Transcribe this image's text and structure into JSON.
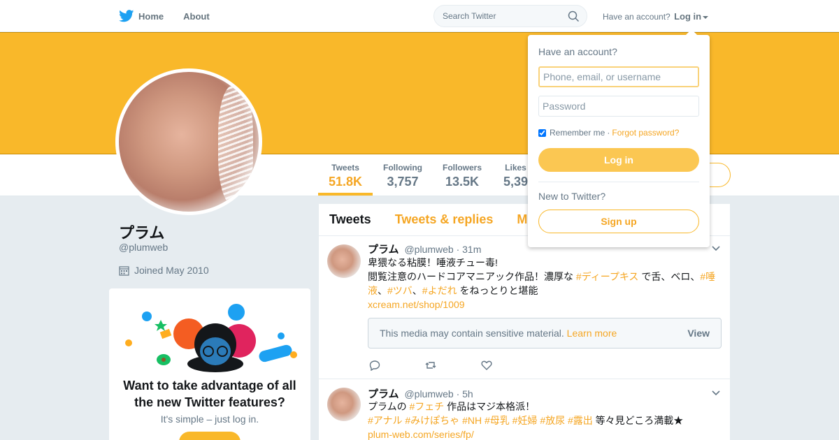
{
  "nav": {
    "home": "Home",
    "about": "About",
    "search_placeholder": "Search Twitter",
    "have_account": "Have an account?",
    "login": "Log in"
  },
  "stats": [
    {
      "label": "Tweets",
      "value": "51.8K"
    },
    {
      "label": "Following",
      "value": "3,757"
    },
    {
      "label": "Followers",
      "value": "13.5K"
    },
    {
      "label": "Likes",
      "value": "5,39"
    }
  ],
  "profile": {
    "name": "プラム",
    "handle": "@plumweb",
    "joined": "Joined May 2010"
  },
  "promo": {
    "title": "Want to take advantage of all the new Twitter features?",
    "subtitle": "It's simple – just log in."
  },
  "timeline": {
    "tabs": [
      "Tweets",
      "Tweets & replies",
      "M"
    ],
    "tweets": [
      {
        "name": "プラム",
        "handle": "@plumweb",
        "time": "· 31m",
        "line1": "卑猥なる粘膜！唾液チュー毒!",
        "line2a": "閲覧注意のハードコアマニアック作品！濃厚な ",
        "tag1": "#ディープキス",
        "line2b": " で舌、ベロ、",
        "tag2": "#唾液",
        "sep1": "、",
        "tag3": "#ツバ",
        "sep2": "、",
        "tag4": "#よだれ",
        "line2c": " をねっとりと堪能",
        "link": "xcream.net/shop/1009",
        "media_warning": "This media may contain sensitive material.",
        "learn_more": "Learn more",
        "view": "View"
      },
      {
        "name": "プラム",
        "handle": "@plumweb",
        "time": "· 5h",
        "line1a": "プラムの ",
        "tag1": "#フェチ",
        "line1b": " 作品はマジ本格派！",
        "tags": "#アナル #みけぽちゃ #NH #母乳 #妊婦 #放尿 #露出",
        "line2b": " 等々見どころ満載★",
        "link": "plum-web.com/series/fp/"
      }
    ]
  },
  "login_dropdown": {
    "title": "Have an account?",
    "username_placeholder": "Phone, email, or username",
    "password_placeholder": "Password",
    "remember": "Remember me",
    "dot": "·",
    "forgot": "Forgot password?",
    "login_button": "Log in",
    "new_to": "New to Twitter?",
    "signup_button": "Sign up"
  },
  "colors": {
    "accent": "#f9b82a",
    "link": "#f5a623"
  }
}
